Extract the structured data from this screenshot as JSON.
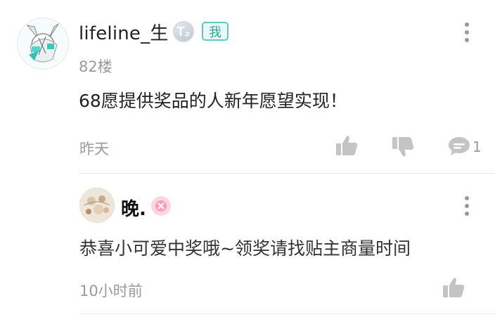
{
  "comment": {
    "username": "lifeline_生",
    "level_badge_text": "T₂",
    "me_tag": "我",
    "floor": "82楼",
    "content": "68愿提供奖品的人新年愿望实现！",
    "time": "昨天",
    "reply_count": "1"
  },
  "reply": {
    "username": "晚.",
    "content": "恭喜小可爱中奖哦~领奖请找贴主商量时间",
    "time": "10小时前"
  },
  "icons": {
    "avatar_main": "anime-avatar",
    "level": "level-badge-icon",
    "more": "more-vertical-icon",
    "like": "thumbs-up-icon",
    "dislike": "thumbs-down-icon",
    "comment": "comment-bubble-icon",
    "reply_badge": "pink-badge-icon"
  },
  "colors": {
    "accent": "#62c7c4",
    "secondary_text": "#9a9a9a",
    "icon_gray": "#c4c4c4",
    "badge_pink": "#ffd6df"
  }
}
